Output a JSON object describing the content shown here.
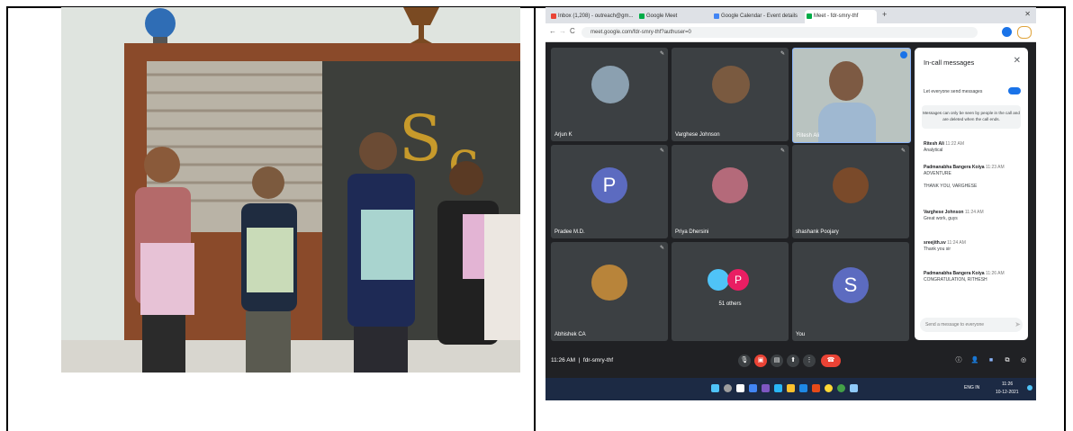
{
  "meet": {
    "tabs": [
      "Inbox (1,208) - outreach@gm...",
      "Google Meet",
      "Google Calendar - Event details",
      "Meet - fdr-smry-thf"
    ],
    "url": "meet.google.com/fdr-smry-thf?authuser=0",
    "participants": [
      "Arjun K",
      "Varghese Johnson",
      "Ritesh Ali",
      "Pradee M.D.",
      "Priya Dhersini",
      "shashank Poojary",
      "Abhishek CA",
      "51 others",
      "You"
    ],
    "avatar_letters": {
      "pradee": "P",
      "others": "P",
      "you": "S"
    },
    "time_meeting": "11:26 AM  |  fdr-smry-thf",
    "chat": {
      "title": "In-call messages",
      "toggle_label": "Let everyone send messages",
      "notice": "Messages can only be seen by people in the call and are deleted when the call ends.",
      "messages": [
        {
          "name": "Ritesh Ali",
          "time": "11:22 AM",
          "lines": [
            "Analytical"
          ]
        },
        {
          "name": "Padmanabha Bangera Koiya",
          "time": "11:23 AM",
          "lines": [
            "ADVENTURE",
            "THANK YOU, VARGHESE"
          ]
        },
        {
          "name": "Varghese Johnson",
          "time": "11:24 AM",
          "lines": [
            "Great work, guys"
          ]
        },
        {
          "name": "sreejith.sv",
          "time": "11:24 AM",
          "lines": [
            "Thank you sir"
          ]
        },
        {
          "name": "Padmanabha Bangera Koiya",
          "time": "11:26 AM",
          "lines": [
            "CONGRATULATION, RITHESH"
          ]
        }
      ],
      "input_placeholder": "Send a message to everyone"
    },
    "taskbar": {
      "lang": "ENG IN",
      "clock": "11:26",
      "date": "10-12-2021"
    }
  },
  "colors": {
    "pradee": "#5c6bc0",
    "others": "#e91e63",
    "you": "#5c6bc0",
    "end_call": "#ea4335",
    "accent": "#1a73e8"
  }
}
